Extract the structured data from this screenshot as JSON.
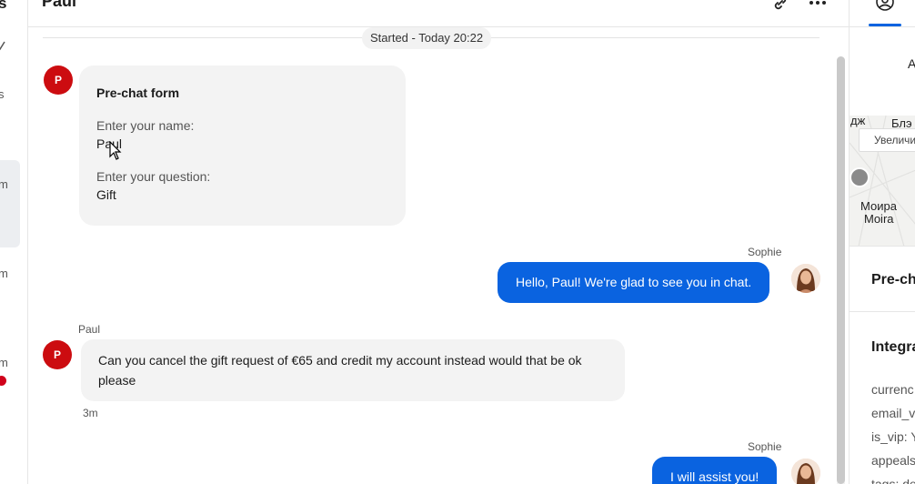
{
  "sidebar": {
    "items": [
      {
        "label": "s"
      },
      {
        "label": "m"
      },
      {
        "label": "m"
      },
      {
        "label": "m"
      }
    ]
  },
  "header": {
    "title": "Paul",
    "icons": [
      "link-icon",
      "more-icon"
    ]
  },
  "chat": {
    "started": "Started - Today 20:22",
    "prechat": {
      "avatar_initial": "P",
      "title": "Pre-chat form",
      "fields": [
        {
          "label": "Enter your name:",
          "value": "Paul"
        },
        {
          "label": "Enter your question:",
          "value": "Gift"
        }
      ]
    },
    "messages": [
      {
        "author": "Sophie",
        "text": "Hello, Paul! We're glad to see you in chat.",
        "direction": "out"
      },
      {
        "author": "Paul",
        "text": "Can you cancel the gift request of €65 and credit my account instead would that be ok please",
        "direction": "in",
        "avatar_initial": "P",
        "time": "3m"
      },
      {
        "author": "Sophie",
        "text": "I will assist you!",
        "direction": "out"
      }
    ]
  },
  "right_panel": {
    "partial_label": "A",
    "map": {
      "labels": [
        "дж",
        "Блэ",
        "Моира",
        "Moira"
      ],
      "zoom_label": "Увеличи"
    },
    "prechat_title": "Pre-ch",
    "integration_title": "Integra",
    "attributes": [
      "currenc",
      "email_v",
      "is_vip: Y",
      "appeals",
      "tags: de"
    ]
  },
  "colors": {
    "accent": "#0a63e0",
    "avatar_red": "#cc0c10",
    "bubble_gray": "#f3f3f3"
  }
}
